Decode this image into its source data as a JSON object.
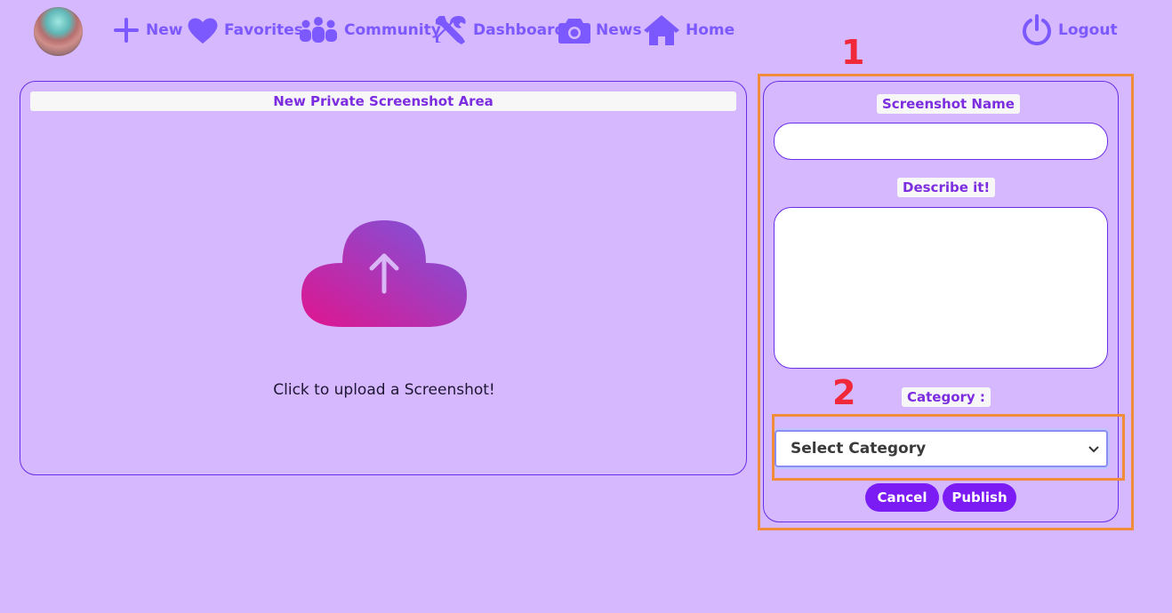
{
  "nav": {
    "items": [
      {
        "label": "New",
        "icon": "plus-icon"
      },
      {
        "label": "Favorites",
        "icon": "heart-icon"
      },
      {
        "label": "Community",
        "icon": "people-icon"
      },
      {
        "label": "Dashboard",
        "icon": "tools-icon"
      },
      {
        "label": "News",
        "icon": "camera-icon"
      },
      {
        "label": "Home",
        "icon": "home-icon"
      }
    ],
    "logout": {
      "label": "Logout",
      "icon": "power-icon"
    }
  },
  "upload_area": {
    "title": "New Private Screenshot Area",
    "text": "Click to upload a Screenshot!"
  },
  "form": {
    "name_label": "Screenshot Name",
    "name_value": "",
    "describe_label": "Describe it!",
    "describe_value": "",
    "category_label": "Category :",
    "category_selected": "Select Category",
    "cancel_label": "Cancel",
    "publish_label": "Publish"
  },
  "annotations": [
    {
      "label": "1"
    },
    {
      "label": "2"
    }
  ],
  "colors": {
    "background": "#d5b8fd",
    "accent": "#7c1cf5",
    "nav_icon": "#7c59ff",
    "highlight": "#f08c3a",
    "marker": "#f0283a"
  }
}
